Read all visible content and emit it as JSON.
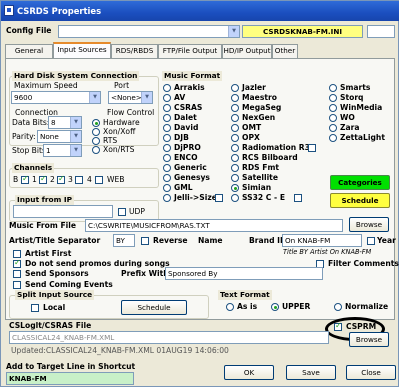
{
  "window": {
    "title": "CSRDS Properties"
  },
  "config": {
    "label": "Config File",
    "value": "CSRDSKNAB-FM.INI"
  },
  "tabs": [
    "General",
    "Input Sources",
    "RDS/RBDS",
    "FTP/File Output",
    "HD/IP Output",
    "Other"
  ],
  "hard_disk": {
    "title": "Hard Disk System Connection",
    "max_speed_label": "Maximum Speed",
    "max_speed_value": "9600",
    "port_label": "Port",
    "port_value": "<None>",
    "connection_label": "Connection",
    "data_bits_label": "Data Bits:",
    "data_bits_value": "8",
    "parity_label": "Parity:",
    "parity_value": "None",
    "stop_bits_label": "Stop Bits:",
    "stop_bits_value": "1",
    "flow_label": "Flow Control",
    "flow_options": [
      "Hardware",
      "Xon/Xoff",
      "RTS",
      "Xon/RTS"
    ]
  },
  "channels": {
    "title": "Channels",
    "items": [
      "B",
      "1",
      "2",
      "3",
      "4",
      "WEB"
    ]
  },
  "input_ip": {
    "title": "Input from IP",
    "udp": "UDP"
  },
  "music_format": {
    "title": "Music Format",
    "col1": [
      "Arrakis",
      "AV",
      "CSRAS",
      "Dalet",
      "David",
      "DJB",
      "DjPRO",
      "ENCO",
      "Generic",
      "Genesys",
      "GML",
      "Jelli->Size"
    ],
    "col2": [
      "Jazler",
      "Maestro",
      "MegaSeg",
      "NexGen",
      "OMT",
      "OPX",
      "Radiomation R3",
      "RCS Bilboard",
      "RDS Fmt",
      "Satellite",
      "Simian",
      "SS32 C - E"
    ],
    "col3": [
      "Smarts",
      "Storq",
      "WinMedia",
      "WO",
      "Zara",
      "ZettaLight"
    ],
    "categories_btn": "Categories",
    "schedule_btn": "Schedule"
  },
  "music_file": {
    "label": "Music From File",
    "value": "C:\\CSWRITE\\MUSICFROM\\RAS.TXT",
    "browse": "Browse"
  },
  "artist": {
    "sep_label": "Artist/Title Separator",
    "sep_value": "BY",
    "reverse_label": "Reverse",
    "name_label": "Name",
    "brand_label": "Brand ID",
    "brand_value": "On KNAB-FM",
    "year_label": "Year",
    "title_hint": "Title BY Artist On KNAB-FM",
    "artist_first": "Artist First",
    "no_promos": "Do not send promos during songs",
    "filter": "Filter Comments",
    "sponsors": "Send Sponsors",
    "prefix_label": "Prefix With",
    "prefix_value": "Sponsored By",
    "coming": "Send Coming Events"
  },
  "split": {
    "title": "Split Input Source",
    "local": "Local",
    "schedule": "Schedule"
  },
  "text_format": {
    "title": "Text Format",
    "options": [
      "As is",
      "UPPER",
      "Normalize"
    ]
  },
  "cslog": {
    "title": "CSLoglt/CSRAS File",
    "cs_prm": "CSPRM",
    "value": "CLASSICAL24_KNAB-FM.XML",
    "browse": "Browse",
    "updated": "Updated:CLASSICAL24_KNAB-FM.XML 01AUG19 14:06:00"
  },
  "shortcut": {
    "label": "Add to Target Line in Shortcut",
    "value": "KNAB-FM"
  },
  "buttons": {
    "ok": "OK",
    "save": "Save",
    "close": "Close"
  },
  "colors": {
    "config_bg": "#ffff80",
    "categories_bg": "#00e000",
    "schedule_bg": "#ffff40",
    "shortcut_bg": "#c8f0c8"
  }
}
